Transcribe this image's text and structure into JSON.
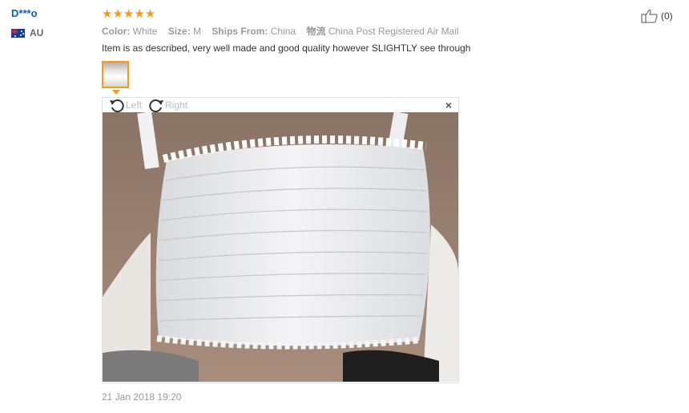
{
  "review": {
    "user": "D***o",
    "country": "AU",
    "stars": "★★★★★",
    "attributes": [
      {
        "key": "Color:",
        "value": "White"
      },
      {
        "key": "Size:",
        "value": "M"
      },
      {
        "key": "Ships From:",
        "value": "China"
      },
      {
        "key": "物流",
        "value": "China Post Registered Air Mail"
      }
    ],
    "text": "Item is as described, very well made and good quality however SLIGHTLY see through",
    "date": "21 Jan 2018 19:20",
    "helpful_count": "(0)"
  },
  "viewer": {
    "rotate_left": "Left",
    "rotate_right": "Right",
    "close": "×"
  },
  "colors": {
    "username": "#0a5fb0",
    "star": "#f59a1e",
    "muted": "#999999"
  },
  "icons": [
    "flag-au-icon",
    "rotate-left-icon",
    "rotate-right-icon",
    "close-icon",
    "thumbs-up-icon"
  ]
}
